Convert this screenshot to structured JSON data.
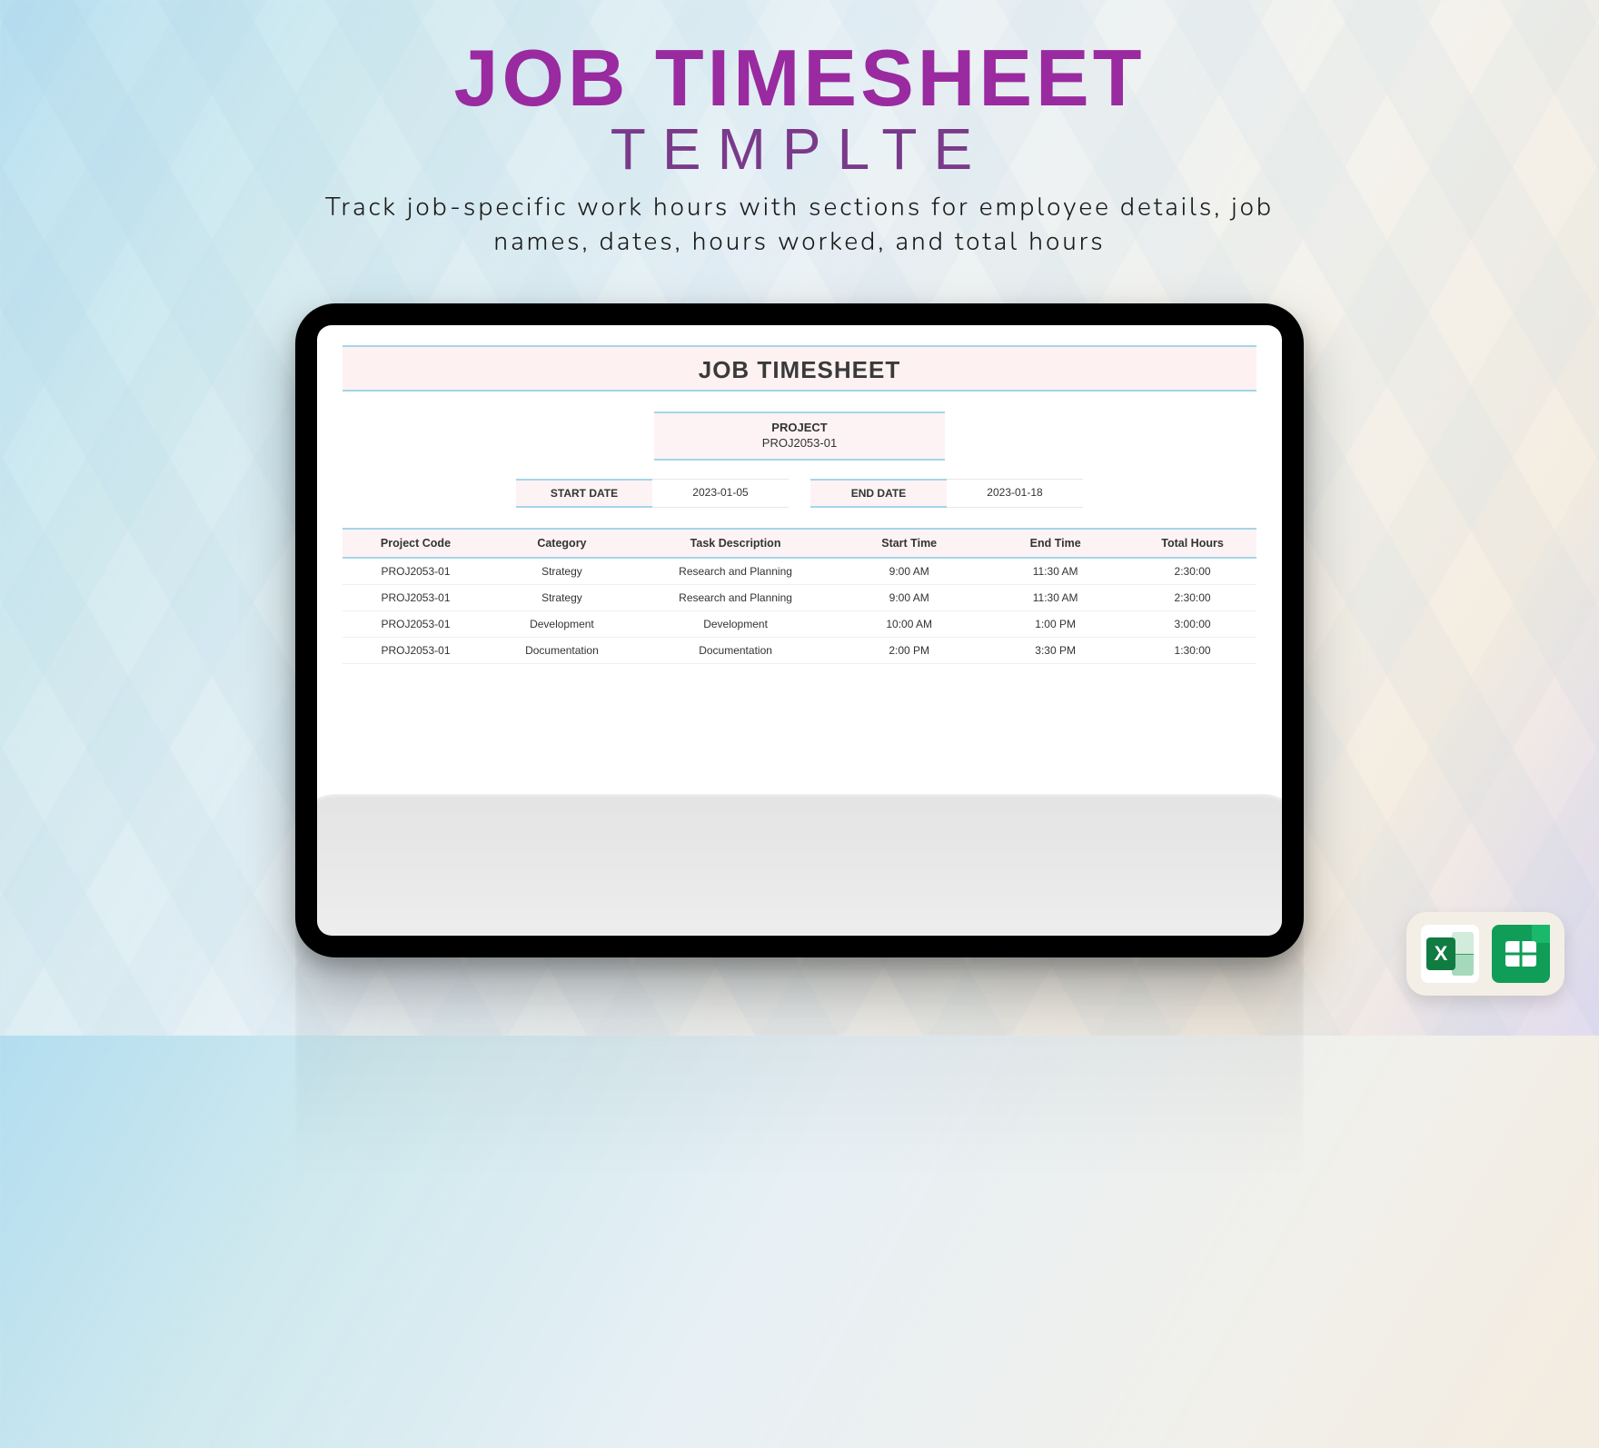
{
  "hero": {
    "title_line1": "JOB TIMESHEET",
    "title_line2": "TEMPLTE",
    "subtitle_line1": "Track job-specific work hours with sections for employee details, job",
    "subtitle_line2": "names, dates, hours worked, and total hours"
  },
  "sheet": {
    "title": "JOB TIMESHEET",
    "project": {
      "label": "PROJECT",
      "value": "PROJ2053-01"
    },
    "dates": {
      "start_label": "START DATE",
      "start_value": "2023-01-05",
      "end_label": "END DATE",
      "end_value": "2023-01-18"
    },
    "columns": [
      "Project Code",
      "Category",
      "Task Description",
      "Start Time",
      "End Time",
      "Total Hours"
    ],
    "rows": [
      {
        "code": "PROJ2053-01",
        "category": "Strategy",
        "task": "Research and Planning",
        "start": "9:00 AM",
        "end": "11:30 AM",
        "total": "2:30:00"
      },
      {
        "code": "PROJ2053-01",
        "category": "Strategy",
        "task": "Research and Planning",
        "start": "9:00 AM",
        "end": "11:30 AM",
        "total": "2:30:00"
      },
      {
        "code": "PROJ2053-01",
        "category": "Development",
        "task": "Development",
        "start": "10:00 AM",
        "end": "1:00 PM",
        "total": "3:00:00"
      },
      {
        "code": "PROJ2053-01",
        "category": "Documentation",
        "task": "Documentation",
        "start": "2:00 PM",
        "end": "3:30 PM",
        "total": "1:30:00"
      }
    ]
  },
  "icons": {
    "excel": "excel-icon",
    "sheets": "google-sheets-icon"
  }
}
